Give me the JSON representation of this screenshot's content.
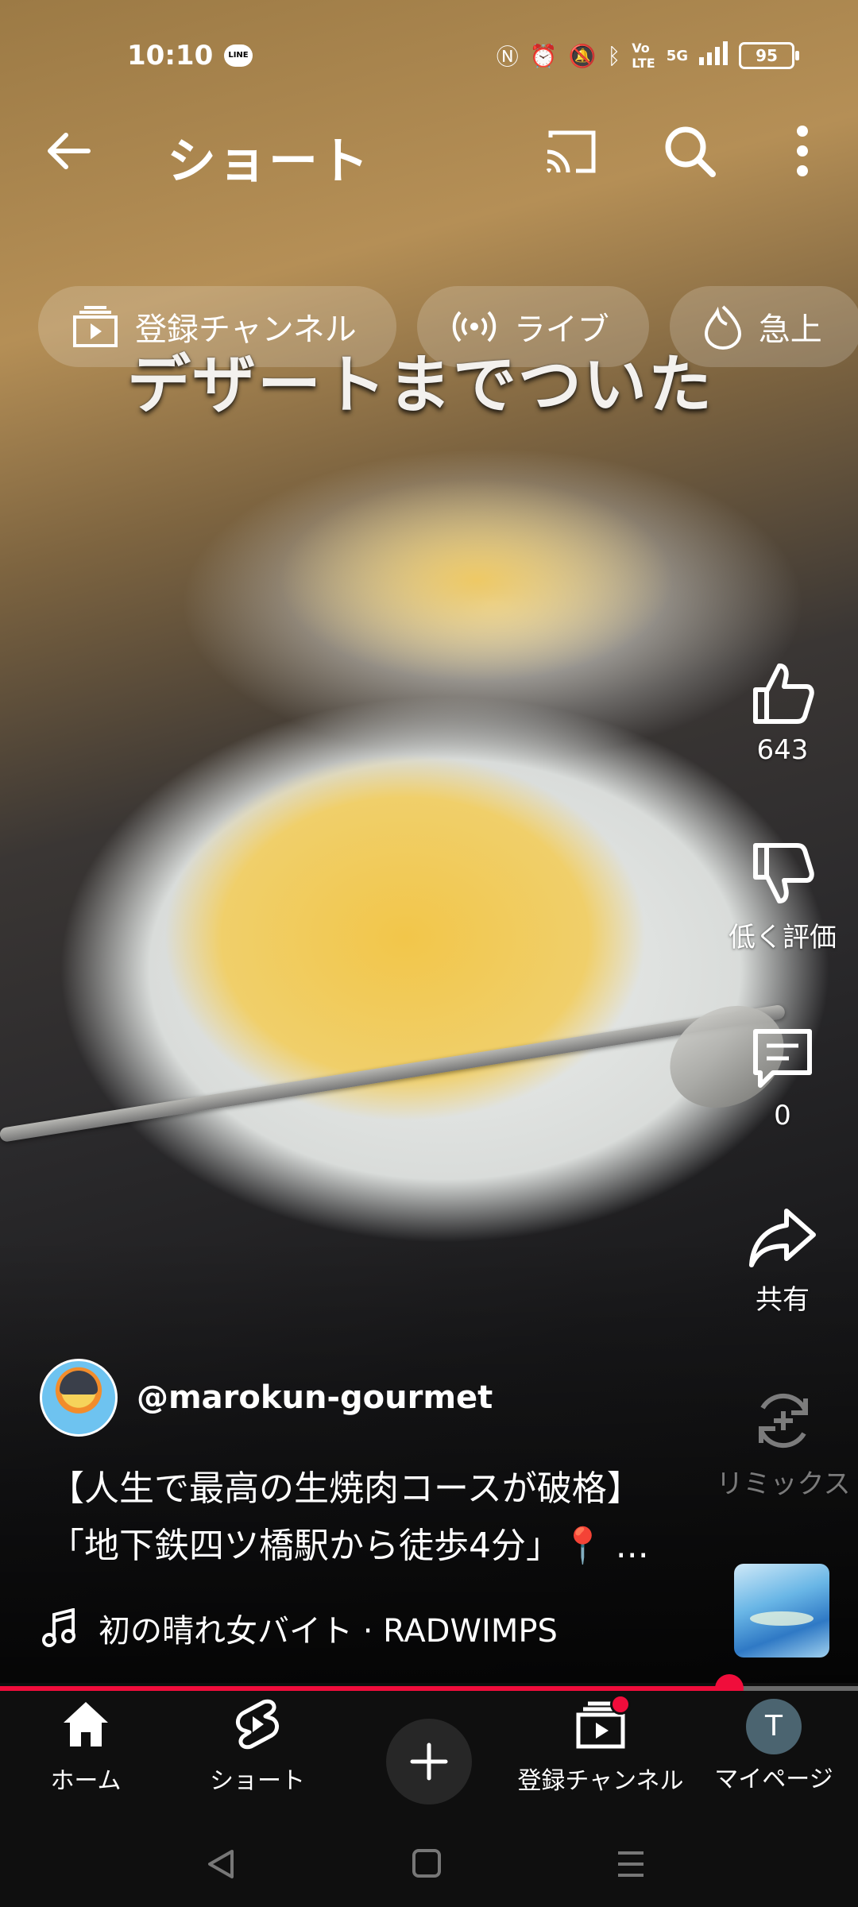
{
  "status": {
    "time": "10:10",
    "line_badge": "LINE",
    "network": "5G",
    "battery": "95"
  },
  "header": {
    "title": "ショート"
  },
  "chips": [
    {
      "label": "登録チャンネル",
      "icon": "subscriptions-icon"
    },
    {
      "label": "ライブ",
      "icon": "live-icon"
    },
    {
      "label": "急上",
      "icon": "trending-icon"
    }
  ],
  "video": {
    "overlay_caption": "デザートまでついた",
    "progress": 0.85
  },
  "actions": {
    "like_count": "643",
    "dislike_label": "低く評価",
    "comment_count": "0",
    "share_label": "共有",
    "remix_label": "リミックス"
  },
  "channel": {
    "handle": "@marokun-gourmet"
  },
  "description": {
    "line1": "【人生で最高の生焼肉コースが破格】",
    "line2": "「地下鉄四ツ橋駅から徒歩4分」📍 ..."
  },
  "music": {
    "track": "初の晴れ女バイト · RADWIMPS"
  },
  "nav": {
    "home": "ホーム",
    "shorts": "ショート",
    "subscriptions": "登録チャンネル",
    "mypage": "マイページ",
    "avatar_initial": "T"
  },
  "colors": {
    "accent": "#f00d3b",
    "background": "#0f0f0f"
  }
}
